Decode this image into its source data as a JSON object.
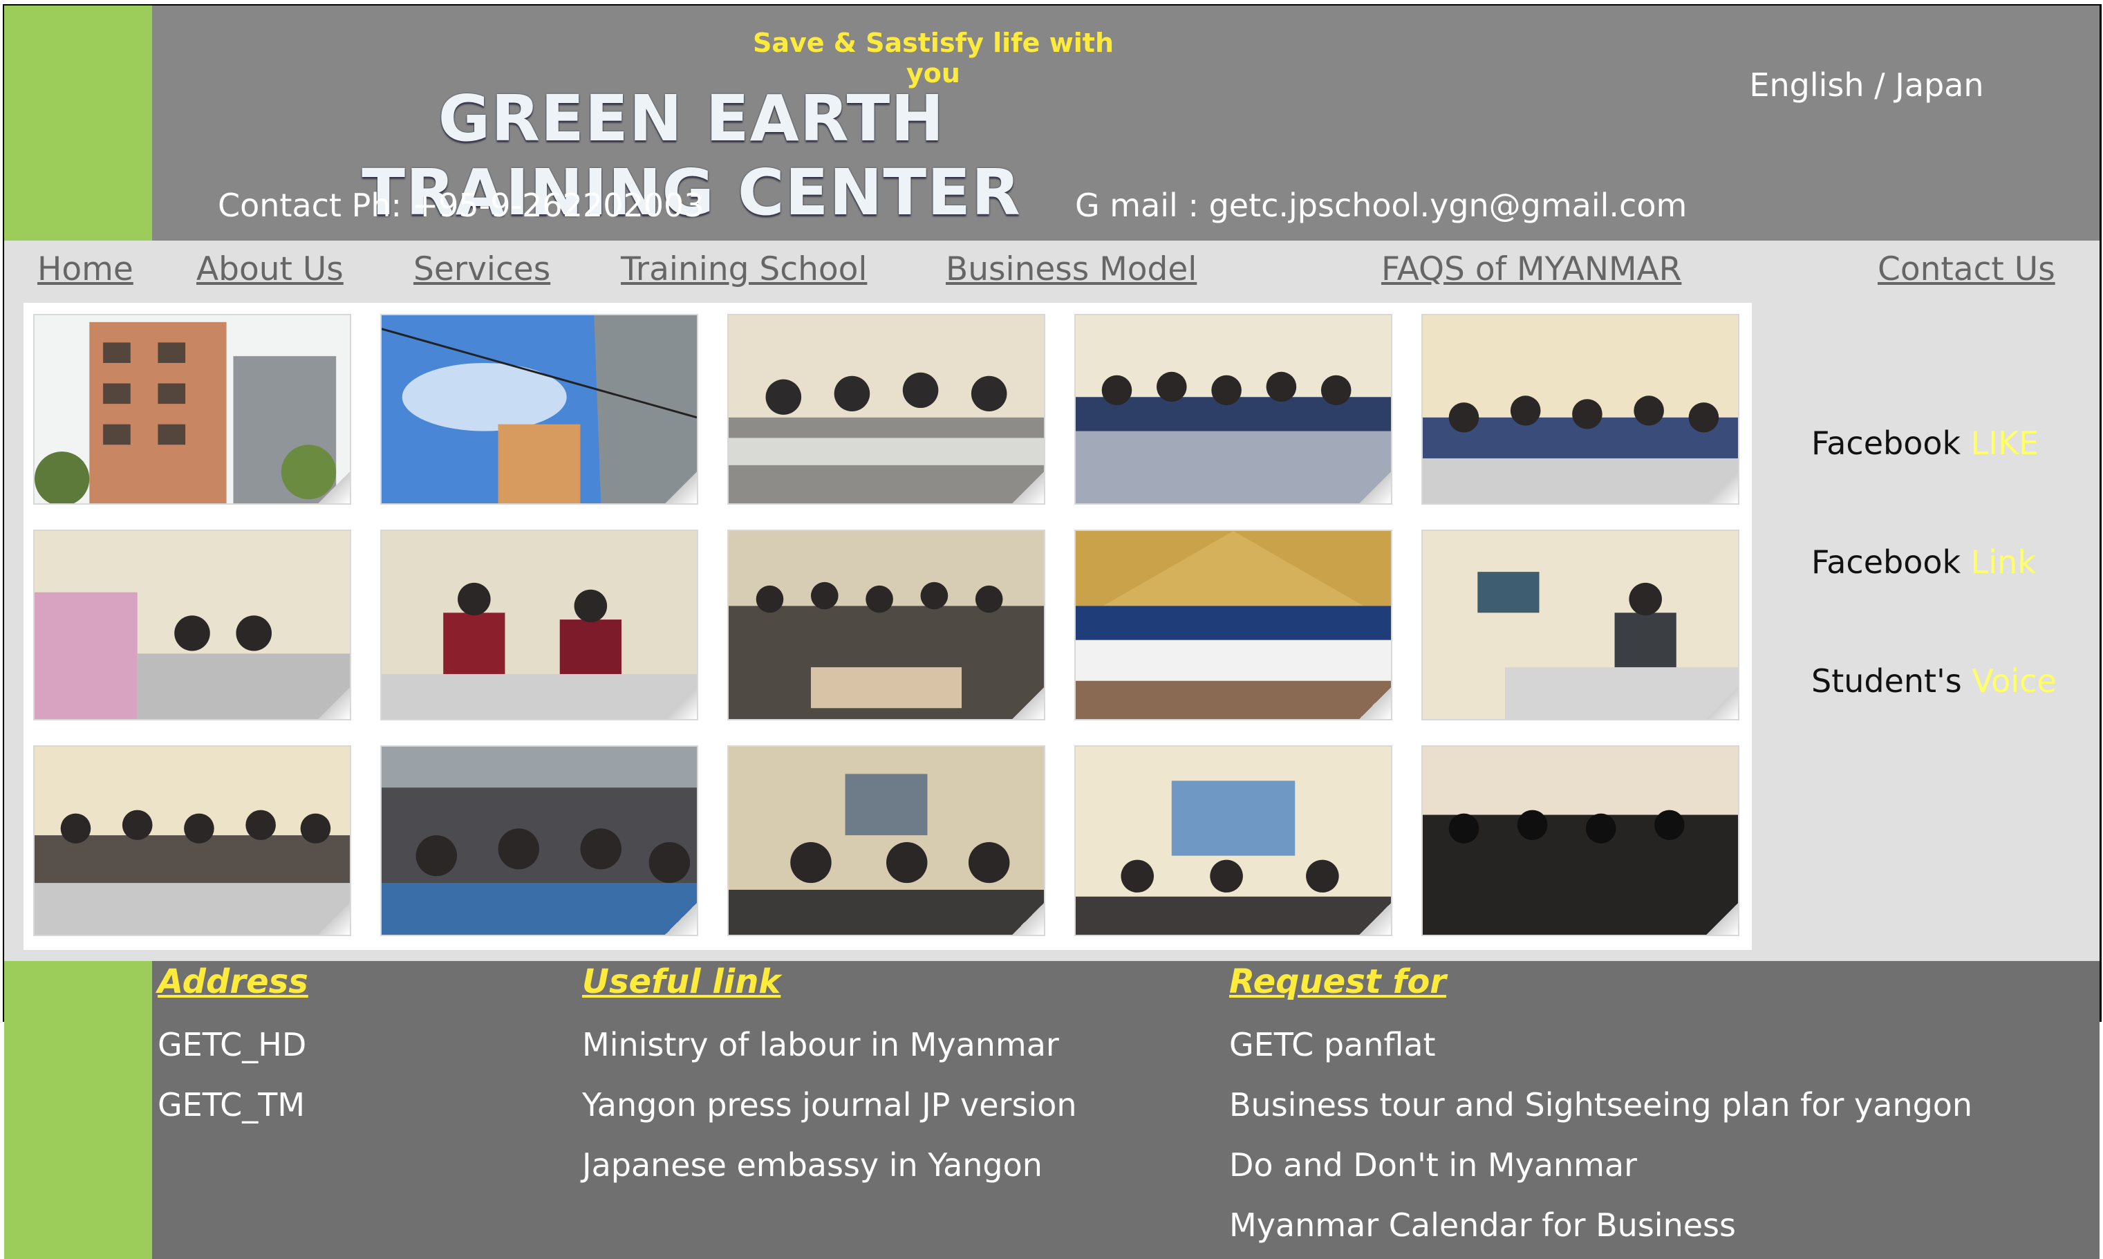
{
  "header": {
    "tagline": "Save & Sastisfy life with you",
    "title": "GREEN EARTH TRAINING CENTER",
    "language": "English / Japan",
    "phone": "Contact Ph: +95-9-262202003",
    "email": "G mail : getc.jpschool.ygn@gmail.com"
  },
  "nav": [
    {
      "label": "Home"
    },
    {
      "label": "About Us"
    },
    {
      "label": "Services"
    },
    {
      "label": "Training School"
    },
    {
      "label": "Business Model"
    },
    {
      "label": "FAQS of MYANMAR"
    },
    {
      "label": "Contact Us"
    }
  ],
  "side_links": [
    {
      "text": "Facebook ",
      "highlight": "LIKE"
    },
    {
      "text": "Facebook ",
      "highlight": "Link"
    },
    {
      "text": "Student's ",
      "highlight": "Voice"
    }
  ],
  "footer": {
    "address": {
      "heading": "Address",
      "items": [
        "GETC_HD",
        "GETC_TM"
      ]
    },
    "useful": {
      "heading": "Useful link",
      "items": [
        "Ministry of labour in Myanmar",
        "Yangon press journal JP version",
        "Japanese embassy in Yangon"
      ]
    },
    "request": {
      "heading": "Request for",
      "items": [
        "GETC panflat",
        "Business tour and Sightseeing plan for yangon",
        "Do and Don't in Myanmar",
        "Myanmar Calendar for Business"
      ]
    }
  },
  "colors": {
    "tagline": "#ffeb3b",
    "header_bg": "#878787",
    "footer_bg": "#707070",
    "green_bar": "#9ccc5a",
    "nav_bg": "#e0e0e0",
    "highlight": "#ffff66"
  }
}
